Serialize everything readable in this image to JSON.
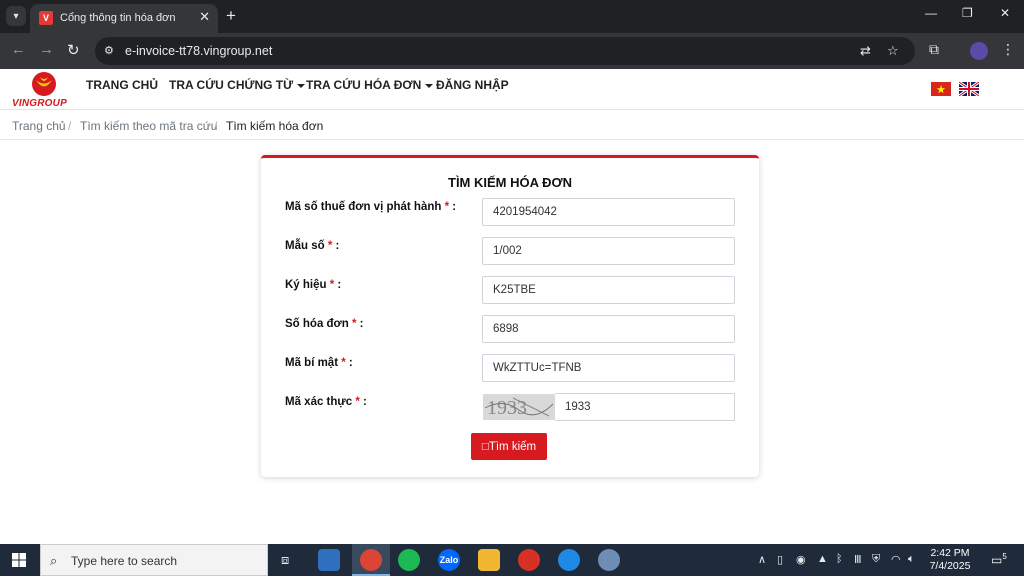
{
  "browser": {
    "tab_title": "Cổng thông tin hóa đơn",
    "tab_close": "✕",
    "new_tab": "+",
    "url": "e-invoice-tt78.vingroup.net",
    "window_controls": [
      "—",
      "❐",
      "✕"
    ]
  },
  "site": {
    "brand": "VINGROUP",
    "nav": {
      "home": "TRANG CHỦ",
      "voucher_lookup": "TRA CỨU CHỨNG TỪ",
      "invoice_lookup": "TRA CỨU HÓA ĐƠN",
      "login": "ĐĂNG NHẬP"
    },
    "languages": [
      "Vietnamese",
      "English"
    ]
  },
  "breadcrumb": {
    "items": [
      "Trang chủ",
      "Tìm kiếm theo mã tra cứu",
      "Tìm kiếm hóa đơn"
    ],
    "separator": "/"
  },
  "form": {
    "title": "TÌM KIẾM HÓA ĐƠN",
    "required_mark": "*",
    "fields": [
      {
        "label": "Mã số thuế đơn vị phát hành",
        "value": "4201954042"
      },
      {
        "label": "Mẫu số",
        "value": "1/002"
      },
      {
        "label": "Ký hiệu",
        "value": "K25TBE"
      },
      {
        "label": "Số hóa đơn",
        "value": "6898"
      },
      {
        "label": "Mã bí mật",
        "value": "WkZTTUc=TFNB"
      },
      {
        "label": "Mã xác thực",
        "value": "1933"
      }
    ],
    "captcha_text": "1933",
    "search_button": "□Tìm kiếm"
  },
  "taskbar": {
    "search_placeholder": "Type here to search",
    "apps": [
      "Zalo"
    ],
    "time": "2:42 PM",
    "date": "7/4/2025",
    "notification_count": "5"
  },
  "colors": {
    "brand_red": "#d71920",
    "chrome_dark": "#202124",
    "chrome_toolbar": "#35363a",
    "taskbar": "#1f2b3a"
  }
}
